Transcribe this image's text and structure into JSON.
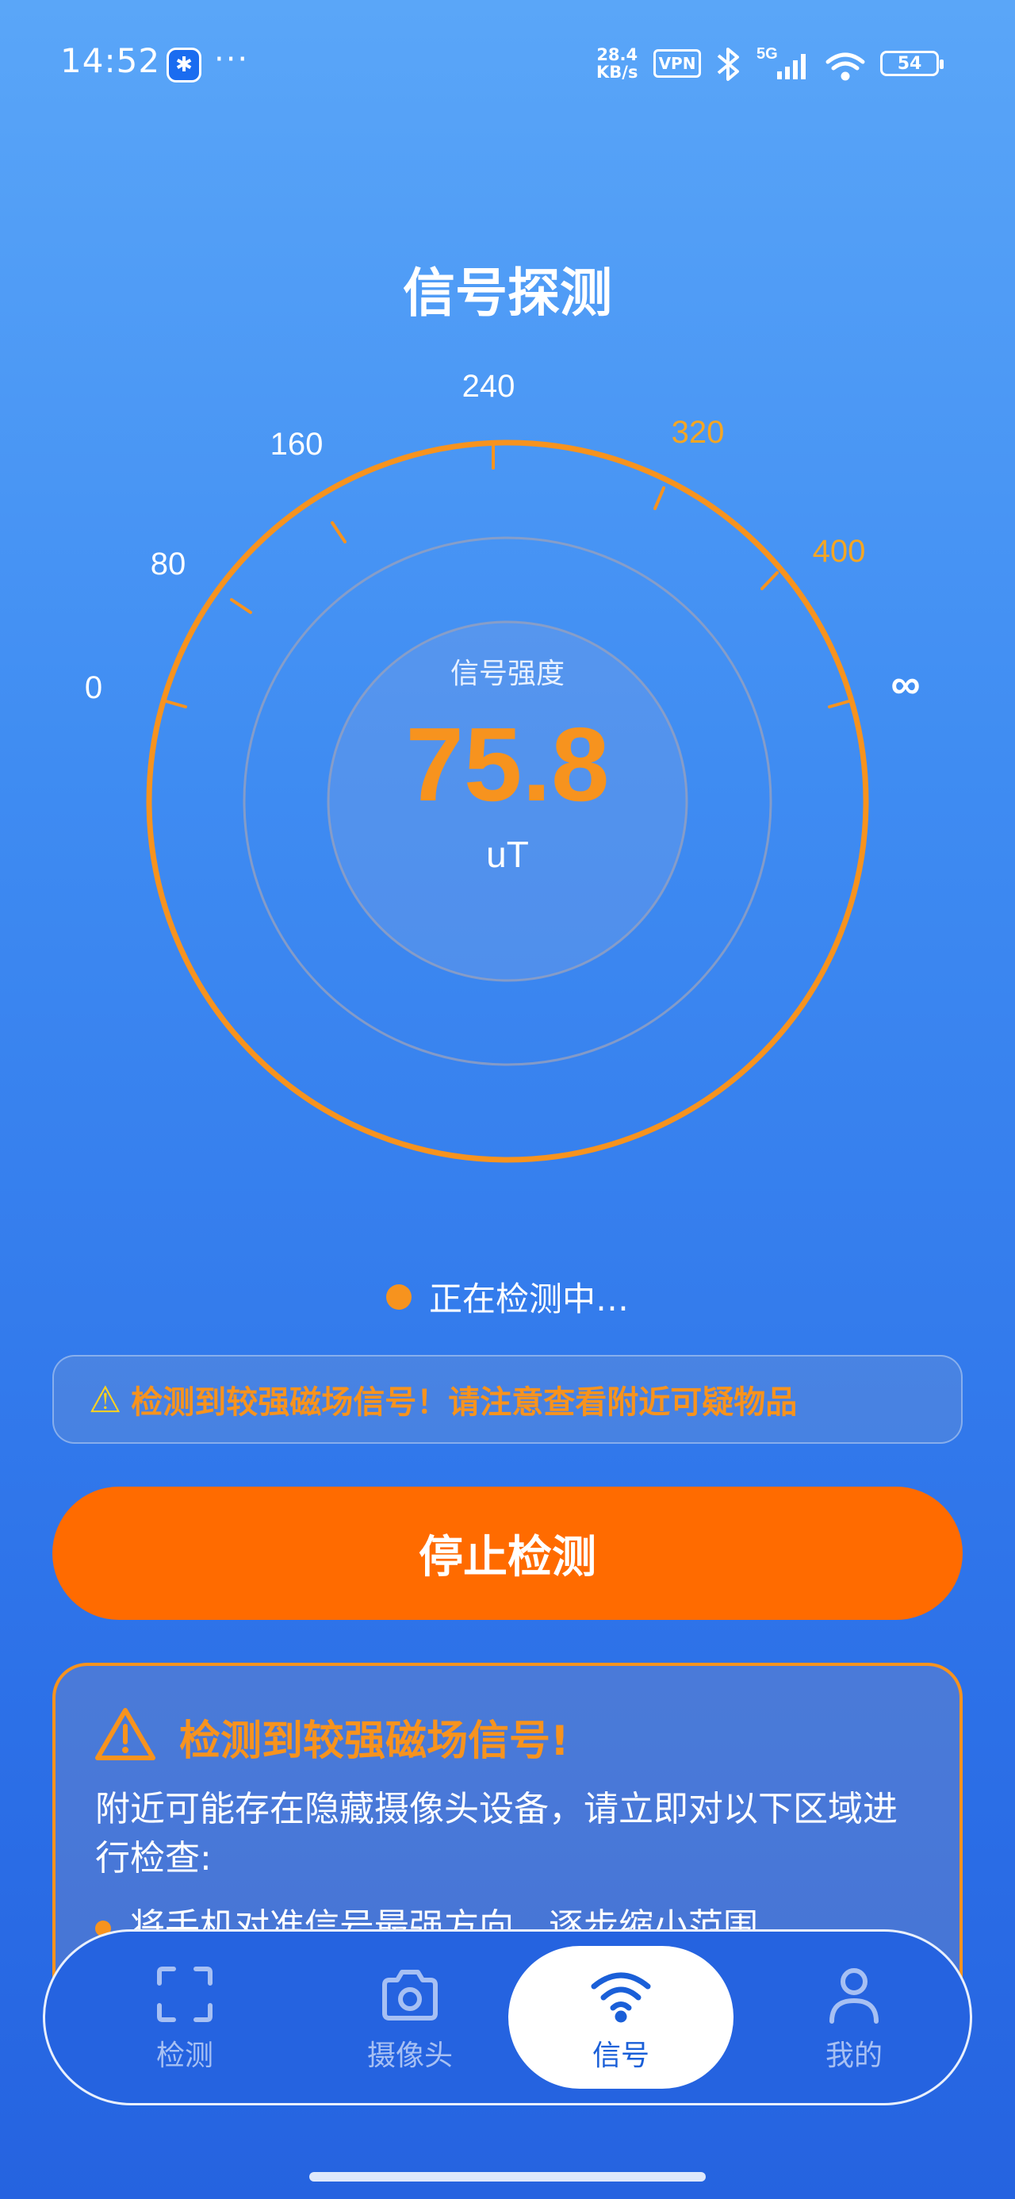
{
  "status_bar": {
    "time": "14:52",
    "app_icon": "✱",
    "more": "···",
    "speed_value": "28.4",
    "speed_unit": "KB/s",
    "vpn": "VPN",
    "network": "5G",
    "battery": "54"
  },
  "page": {
    "title": "信号探测"
  },
  "gauge": {
    "scale_labels": [
      "0",
      "80",
      "160",
      "240",
      "320",
      "400",
      "∞"
    ],
    "caption": "信号强度",
    "value": "75.8",
    "unit": "uT",
    "accent_color": "#f7931e"
  },
  "status": {
    "detecting_text": "正在检测中…"
  },
  "warning_banner": {
    "icon": "⚠",
    "text": "检测到较强磁场信号！请注意查看附近可疑物品"
  },
  "stop_button": {
    "label": "停止检测",
    "color": "#ff6b00"
  },
  "alert_card": {
    "title": "检测到较强磁场信号!",
    "description": "附近可能存在隐藏摄像头设备，请立即对以下区域进行检查:",
    "bullet": "将手机对准信号最强方向，逐步缩小范围"
  },
  "bottom_nav": {
    "items": [
      {
        "label": "检测",
        "icon": "scan-icon"
      },
      {
        "label": "摄像头",
        "icon": "camera-icon"
      },
      {
        "label": "信号",
        "icon": "wifi-icon"
      },
      {
        "label": "我的",
        "icon": "person-icon"
      }
    ],
    "selected": "信号"
  }
}
